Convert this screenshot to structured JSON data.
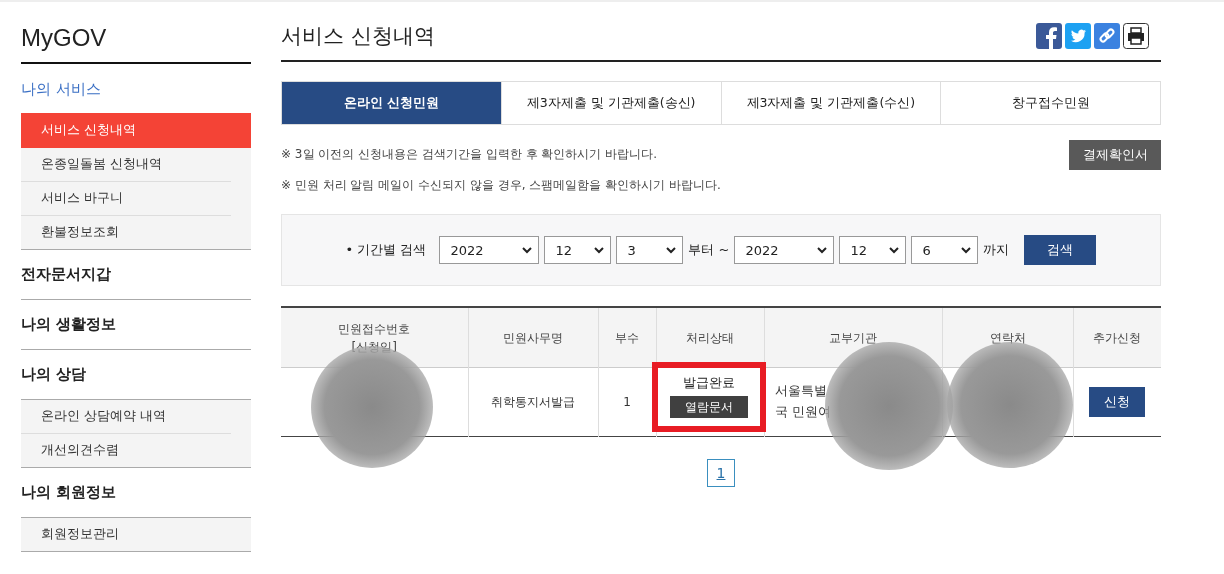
{
  "sidebar": {
    "logo": "MyGOV",
    "sections": [
      {
        "title": "나의 서비스",
        "selected": true,
        "items": [
          {
            "label": "서비스 신청내역",
            "selected": true
          },
          {
            "label": "온종일돌봄 신청내역",
            "selected": false
          },
          {
            "label": "서비스 바구니",
            "selected": false
          },
          {
            "label": "환불정보조회",
            "selected": false
          }
        ]
      },
      {
        "title": "전자문서지갑",
        "selected": false
      },
      {
        "title": "나의 생활정보",
        "selected": false
      },
      {
        "title": "나의 상담",
        "selected": false,
        "items": [
          {
            "label": "온라인 상담예약 내역",
            "selected": false
          },
          {
            "label": "개선의견수렴",
            "selected": false
          }
        ]
      },
      {
        "title": "나의 회원정보",
        "selected": false,
        "items": [
          {
            "label": "회원정보관리",
            "selected": false
          }
        ]
      }
    ]
  },
  "page_title": "서비스 신청내역",
  "tabs": [
    {
      "label": "온라인 신청민원",
      "selected": true
    },
    {
      "label": "제3자제출 및 기관제출(송신)",
      "selected": false
    },
    {
      "label": "제3자제출 및 기관제출(수신)",
      "selected": false
    },
    {
      "label": "창구접수민원",
      "selected": false
    }
  ],
  "notices": [
    "※ 3일 이전의 신청내용은 검색기간을 입력한 후 확인하시기 바랍니다.",
    "※ 민원 처리 알림 메일이 수신되지 않을 경우, 스팸메일함을 확인하시기 바랍니다."
  ],
  "payment_button": "결제확인서",
  "search": {
    "label": "• 기간별 검색",
    "from": [
      "2022",
      "12",
      "3"
    ],
    "from_suffix": "부터 ~",
    "to": [
      "2022",
      "12",
      "6"
    ],
    "to_suffix": "까지",
    "button": "검색"
  },
  "table": {
    "columns": [
      "민원접수번호\n[신청일]",
      "민원사무명",
      "부수",
      "처리상태",
      "교부기관",
      "연락처",
      "추가신청"
    ],
    "rows": [
      {
        "name": "취학통지서발급",
        "copies": "1",
        "status": "발급완료",
        "view_button": "열람문서",
        "agency": "서울특별\n국 민원여",
        "apply_button": "신청"
      }
    ]
  },
  "pagination": [
    {
      "label": "1",
      "selected": true
    }
  ]
}
